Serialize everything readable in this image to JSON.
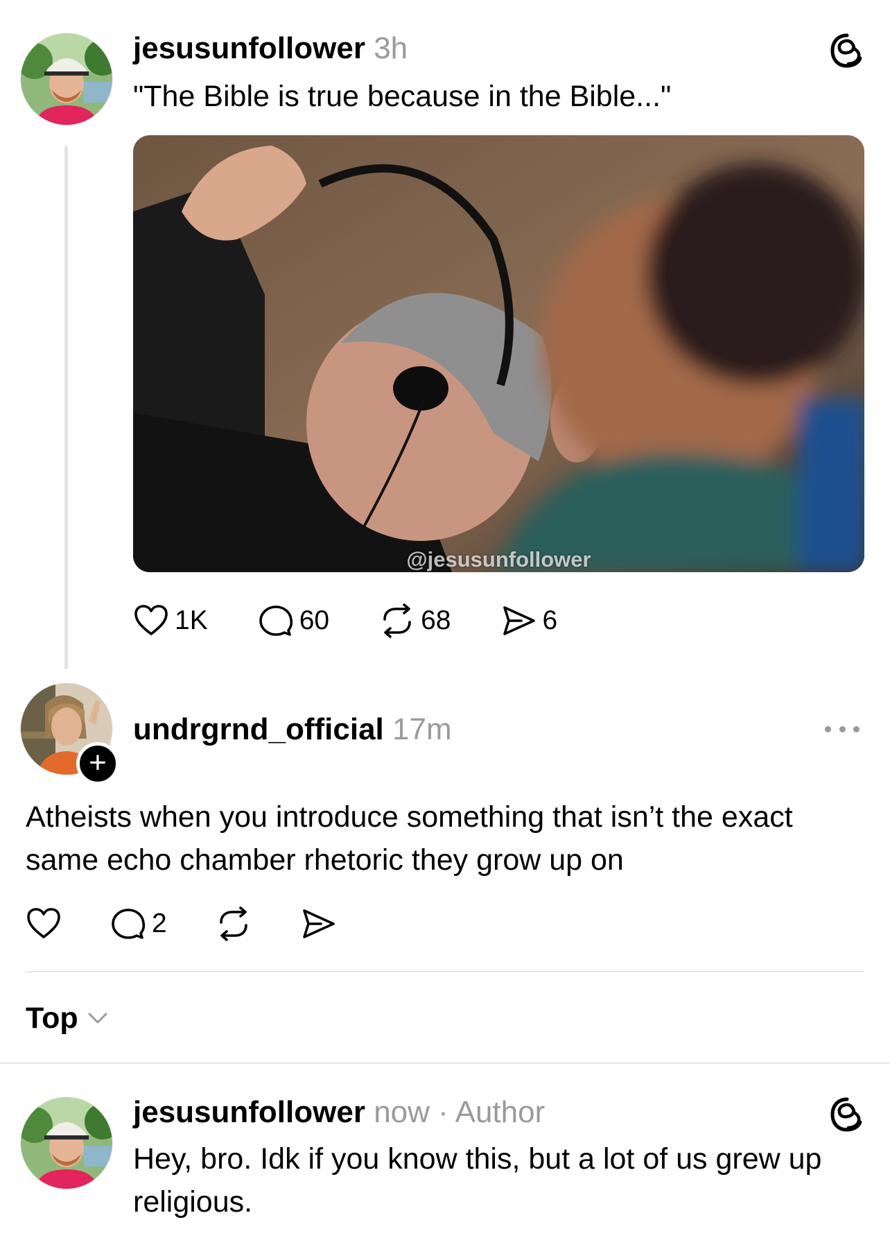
{
  "original_post": {
    "username": "jesusunfollower",
    "time": "3h",
    "text": "\"The Bible is true because in the Bible...\"",
    "media_watermark": "@jesusunfollower",
    "likes": "1K",
    "comments": "60",
    "reposts": "68",
    "shares": "6"
  },
  "quote_post": {
    "username": "undrgrnd_official",
    "time": "17m",
    "follow_symbol": "+",
    "text": "Atheists when you introduce something that isn’t the exact same echo chamber rhetoric they grow up on",
    "comments": "2"
  },
  "sort": {
    "label": "Top"
  },
  "reply": {
    "username": "jesusunfollower",
    "time": "now",
    "separator": "·",
    "badge": "Author",
    "text": "Hey, bro. Idk if you know this, but a lot of us grew up religious."
  },
  "icons": {
    "like": "heart-icon",
    "comment": "comment-icon",
    "repost": "repost-icon",
    "share": "send-icon",
    "threads": "threads-logo-icon",
    "more": "more-icon",
    "sort": "chevron-down-icon"
  },
  "colors": {
    "text": "#000000",
    "meta": "#9a9a9a",
    "divider": "#e8e8e8",
    "background": "#ffffff"
  }
}
